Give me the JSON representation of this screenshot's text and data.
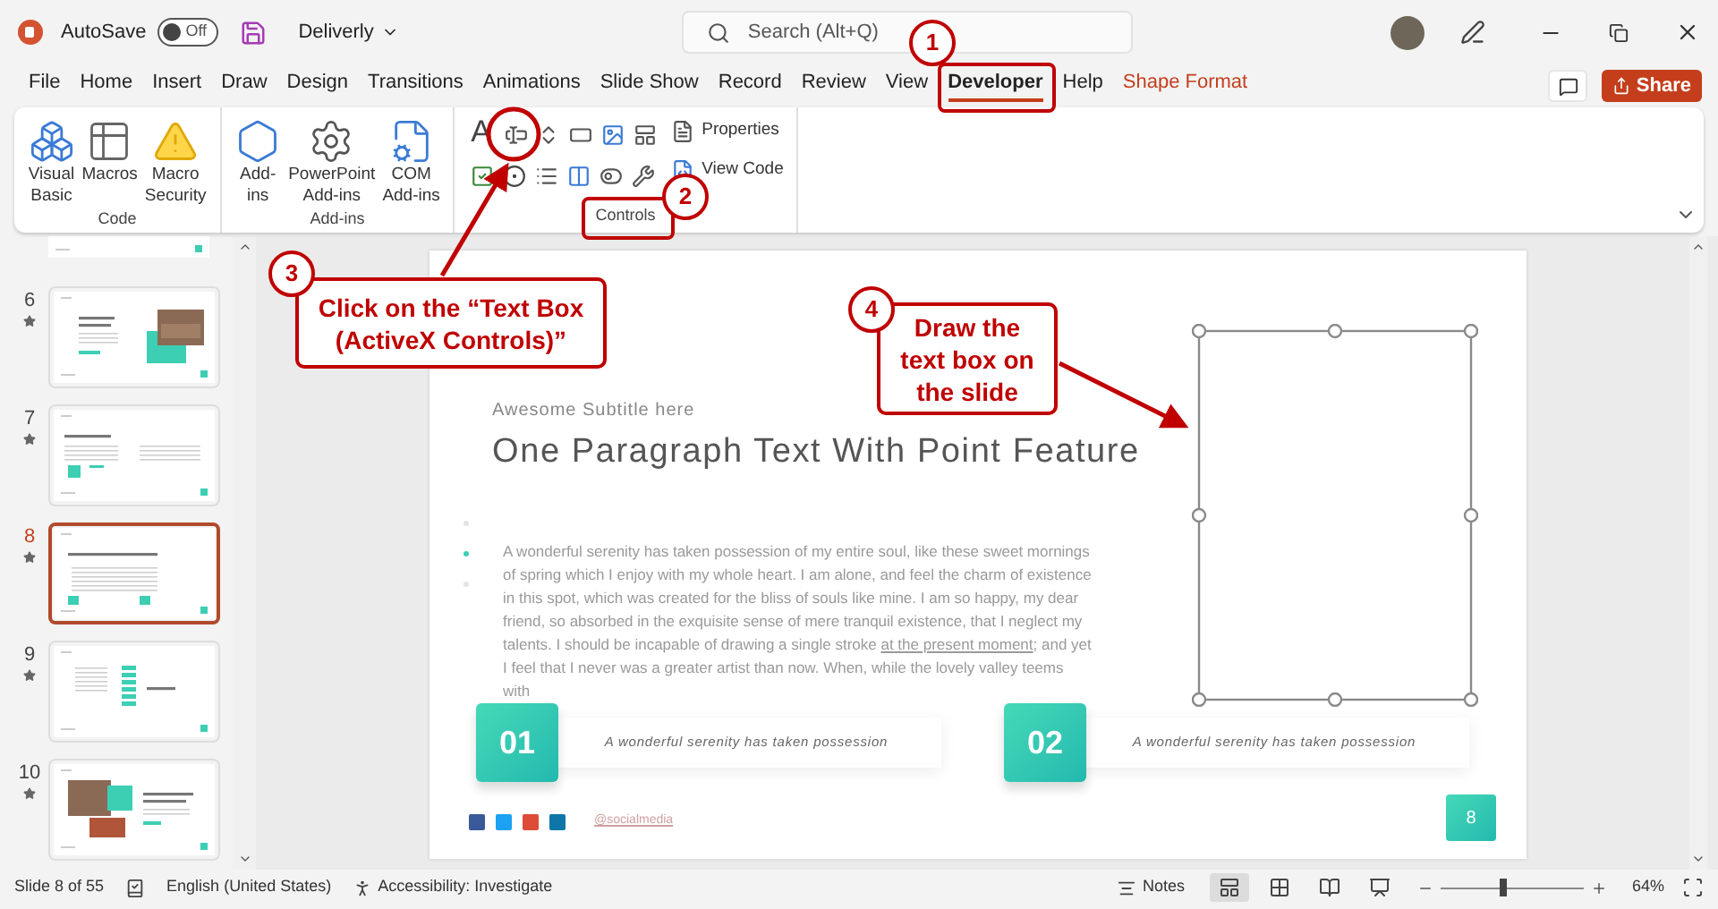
{
  "title_bar": {
    "autosave_label": "AutoSave",
    "autosave": {
      "label": "Off",
      "on": false
    },
    "file_name": "Deliverly",
    "search": {
      "placeholder": "Search (Alt+Q)"
    }
  },
  "tabs": [
    {
      "label": "File",
      "selected": false,
      "kind": "normal"
    },
    {
      "label": "Home",
      "selected": false,
      "kind": "normal"
    },
    {
      "label": "Insert",
      "selected": false,
      "kind": "normal"
    },
    {
      "label": "Draw",
      "selected": false,
      "kind": "normal"
    },
    {
      "label": "Design",
      "selected": false,
      "kind": "normal"
    },
    {
      "label": "Transitions",
      "selected": false,
      "kind": "normal"
    },
    {
      "label": "Animations",
      "selected": false,
      "kind": "normal"
    },
    {
      "label": "Slide Show",
      "selected": false,
      "kind": "normal"
    },
    {
      "label": "Record",
      "selected": false,
      "kind": "normal"
    },
    {
      "label": "Review",
      "selected": false,
      "kind": "normal"
    },
    {
      "label": "View",
      "selected": false,
      "kind": "normal"
    },
    {
      "label": "Developer",
      "selected": true,
      "kind": "normal"
    },
    {
      "label": "Help",
      "selected": false,
      "kind": "normal"
    },
    {
      "label": "Shape Format",
      "selected": false,
      "kind": "contextual"
    }
  ],
  "share_button": {
    "label": "Share"
  },
  "ribbon": {
    "groups": [
      {
        "label": "Code",
        "kind": "large",
        "buttons": [
          "Visual\nBasic",
          "Macros",
          "Macro\nSecurity"
        ]
      },
      {
        "label": "Add-ins",
        "kind": "large",
        "buttons": [
          "Add-\nins",
          "PowerPoint\nAdd-ins",
          "COM\nAdd-ins"
        ]
      },
      {
        "label": "Controls",
        "kind": "controls",
        "glyph": "A",
        "buttons": [
          "Properties",
          "View Code"
        ]
      }
    ]
  },
  "slides_panel": {
    "slides": [
      {
        "number": "6",
        "kind": "photo_right",
        "selected": false
      },
      {
        "number": "7",
        "kind": "two_column",
        "selected": false
      },
      {
        "number": "8",
        "kind": "paragraph",
        "selected": true
      },
      {
        "number": "9",
        "kind": "list",
        "selected": false
      },
      {
        "number": "10",
        "kind": "photos_left",
        "selected": false
      }
    ]
  },
  "slide": {
    "subtitle": "Awesome Subtitle here",
    "title": "One Paragraph Text With Point Feature",
    "dots": [
      {
        "selected": false
      },
      {
        "selected": true
      },
      {
        "selected": false
      }
    ],
    "paragraph": {
      "before": "A wonderful serenity has taken possession of my entire soul, like these sweet mornings of spring which I enjoy with my whole heart. I am alone, and feel the charm of existence in this spot, which was created for the bliss of souls like mine. I am so happy, my dear friend, so absorbed in the exquisite sense of mere tranquil existence, that I neglect my talents. I should be incapable of drawing a single stroke ",
      "link": "at the present moment",
      "after": "; and yet I feel that I never was a greater artist than now. When, while the lovely valley teems with"
    },
    "points": [
      {
        "number": "01",
        "text": "A wonderful serenity has taken possession"
      },
      {
        "number": "02",
        "text": "A wonderful serenity has taken possession"
      }
    ],
    "social_handle": "@socialmedia",
    "page_number": "8"
  },
  "annotations": [
    {
      "number": "1",
      "kind": "marker"
    },
    {
      "number": "2",
      "kind": "marker"
    },
    {
      "number": "3",
      "kind": "callout",
      "text": "Click on the “Text Box\n(ActiveX Controls)”"
    },
    {
      "number": "4",
      "kind": "callout",
      "text": "Draw the\ntext box on\nthe slide"
    }
  ],
  "status_bar": {
    "slide_info": "Slide 8 of 55",
    "language": "English (United States)",
    "accessibility": "Accessibility: Investigate",
    "notes": "Notes",
    "views": [
      {
        "kind": "normal",
        "selected": true
      },
      {
        "kind": "sorter",
        "selected": false
      },
      {
        "kind": "reading",
        "selected": false
      },
      {
        "kind": "slideshow",
        "selected": false
      }
    ],
    "zoom": {
      "level": 0.44,
      "label": "64%"
    }
  }
}
